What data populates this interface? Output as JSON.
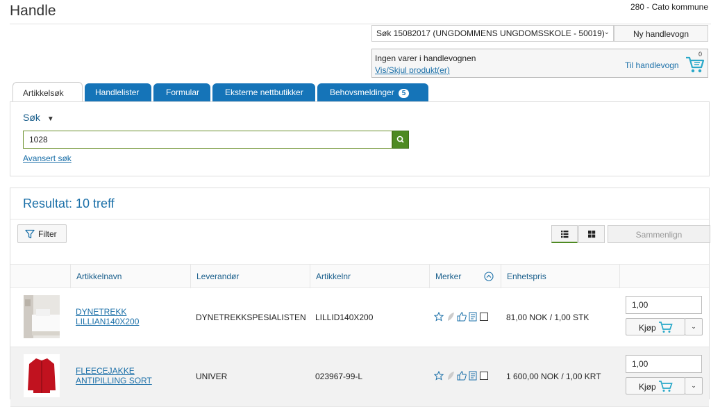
{
  "header": {
    "title": "Handle",
    "org": "280 - Cato kommune"
  },
  "search_select": {
    "value": "Søk 15082017 (UNGDOMMENS UNGDOMSSKOLE - 50019)"
  },
  "new_cart_label": "Ny handlevogn",
  "cart": {
    "empty_text": "Ingen varer i handlevognen",
    "toggle_label": "Vis/Skjul produkt(er)",
    "go_label": "Til handlevogn",
    "count": "0"
  },
  "tabs": [
    {
      "label": "Artikkelsøk"
    },
    {
      "label": "Handlelister"
    },
    {
      "label": "Formular"
    },
    {
      "label": "Eksterne nettbutikker"
    },
    {
      "label": "Behovsmeldinger",
      "badge": "5"
    }
  ],
  "search": {
    "label": "Søk",
    "value": "1028",
    "advanced_label": "Avansert søk"
  },
  "results": {
    "title": "Resultat: 10 treff",
    "filter_label": "Filter",
    "compare_label": "Sammenlign",
    "columns": [
      "Artikkelnavn",
      "Leverandør",
      "Artikkelnr",
      "Merker",
      "Enhetspris"
    ],
    "rows": [
      {
        "name": "DYNETREKK LILLIAN140X200",
        "supplier": "DYNETREKKSPESIALISTEN",
        "artnr": "LILLID140X200",
        "price": "81,00 NOK / 1,00 STK",
        "qty": "1,00",
        "buy_label": "Kjøp"
      },
      {
        "name": "FLEECEJAKKE ANTIPILLING SORT",
        "supplier": "UNIVER",
        "artnr": "023967-99-L",
        "price": "1 600,00 NOK / 1,00 KRT",
        "qty": "1,00",
        "buy_label": "Kjøp"
      }
    ]
  },
  "colors": {
    "accent": "#1574b8",
    "link": "#1a6fa8",
    "search_green": "#4e8a22"
  }
}
